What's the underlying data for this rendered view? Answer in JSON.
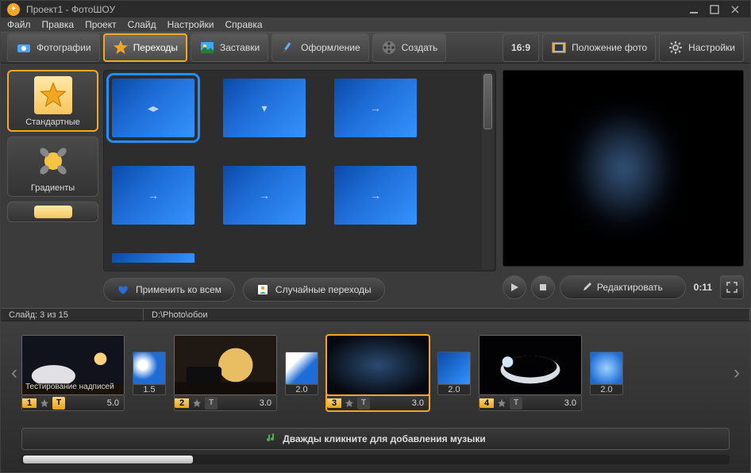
{
  "window": {
    "title": "Проект1 - ФотоШОУ"
  },
  "menu": {
    "file": "Файл",
    "edit": "Правка",
    "project": "Проект",
    "slide": "Слайд",
    "settings": "Настройки",
    "help": "Справка"
  },
  "tabs": {
    "photos": "Фотографии",
    "transitions": "Переходы",
    "intros": "Заставки",
    "design": "Оформление",
    "create": "Создать"
  },
  "rightbar": {
    "aspect": "16:9",
    "position": "Положение фото",
    "settings": "Настройки"
  },
  "categories": {
    "standard": "Стандартные",
    "gradients": "Градиенты"
  },
  "bottom_buttons": {
    "apply_all": "Применить ко всем",
    "random": "Случайные переходы"
  },
  "player": {
    "edit": "Редактировать",
    "time": "0:11"
  },
  "status": {
    "slide_info": "Слайд: 3 из 15",
    "path": "D:\\Photo\\обои"
  },
  "timeline": {
    "slides": [
      {
        "num": "1",
        "dur": "5.0",
        "overlay": "Тестирование надписей"
      },
      {
        "num": "2",
        "dur": "3.0",
        "overlay": ""
      },
      {
        "num": "3",
        "dur": "3.0",
        "overlay": ""
      },
      {
        "num": "4",
        "dur": "3.0",
        "overlay": ""
      }
    ],
    "transitions": [
      {
        "dur": "1.5"
      },
      {
        "dur": "2.0"
      },
      {
        "dur": "2.0"
      },
      {
        "dur": "2.0"
      },
      {
        "dur": "2.0"
      }
    ],
    "music_hint": "Дважды кликните для добавления музыки"
  }
}
